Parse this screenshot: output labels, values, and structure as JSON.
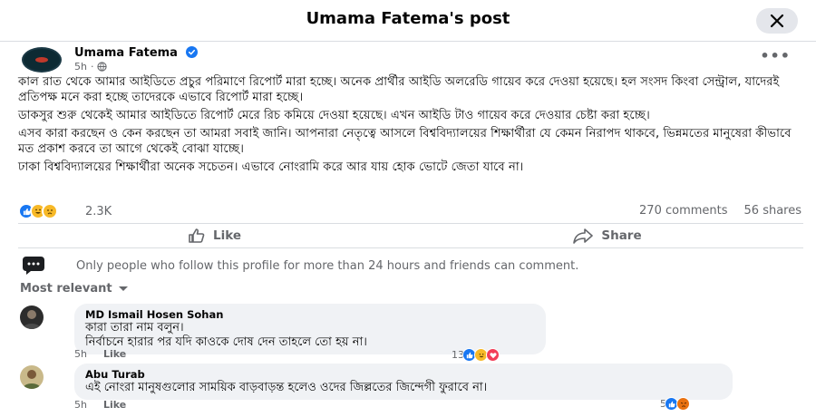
{
  "header": {
    "title": "Umama Fatema's post"
  },
  "post": {
    "author": "Umama Fatema",
    "time": "5h",
    "paragraphs": [
      "কাল রাত থেকে আমার আইডিতে প্রচুর পরিমাণে রিপোর্ট মারা হচ্ছে। অনেক প্রার্থীর আইডি অলরেডি গায়েব করে দেওয়া হয়েছে। হল সংসদ কিংবা সেন্ট্রাল, যাদেরই প্রতিপক্ষ মনে করা হচ্ছে তাদেরকে এভাবে রিপোর্ট মারা হচ্ছে।",
      "ডাকসুর শুরু থেকেই আমার আইডিতে রিপোর্ট মেরে রিচ কমিয়ে দেওয়া হয়েছে। এখন আইডি টাও গায়েব করে দেওয়ার চেষ্টা করা হচ্ছে।",
      "এসব কারা করছেন ও কেন করছেন তা আমরা সবাই জানি। আপনারা নেতৃত্বে আসলে বিশ্ববিদ্যালয়ের শিক্ষার্থীরা যে কেমন নিরাপদ থাকবে, ভিন্নমতের মানুষেরা কীভাবে মত প্রকাশ করবে তা আগে থেকেই বোঝা যাচ্ছে।",
      "ঢাকা বিশ্ববিদ্যালয়ের শিক্ষার্থীরা অনেক সচেতন। এভাবে নোংরামি করে আর যায় হোক ভোটে জেতা যাবে না।"
    ],
    "reaction_count": "2.3K",
    "comments_count": "270 comments",
    "shares_count": "56 shares"
  },
  "actions": {
    "like": "Like",
    "share": "Share"
  },
  "notice": "Only people who follow this profile for more than 24 hours and friends can comment.",
  "filter": "Most relevant",
  "comments": [
    {
      "name": "MD Ismail Hosen Sohan",
      "lines": [
        "কারা তারা নাম বলুন।",
        "নির্বাচনে হারার পর যদি কাওকে দোষ দেন তাহলে তো হয় না।"
      ],
      "time": "5h",
      "like": "Like",
      "reactions": "13"
    },
    {
      "name": "Abu Turab",
      "lines": [
        "এই নোংরা মানুষগুলোর সাময়িক বাড়বাড়ন্ত হলেও ওদের জিল্লতের জিন্দেগী ফুরাবে না।"
      ],
      "time": "5h",
      "like": "Like",
      "reactions": "5"
    }
  ],
  "colors": {
    "like_blue": "#1877f2",
    "love_red": "#f33e58",
    "haha_yellow": "#f7b928",
    "angry_orange": "#e9710f"
  },
  "icons": [
    "close-icon",
    "verified-icon",
    "globe-icon",
    "more-icon",
    "like-icon",
    "share-icon",
    "comment-bubble-icon",
    "chevron-down-icon"
  ]
}
